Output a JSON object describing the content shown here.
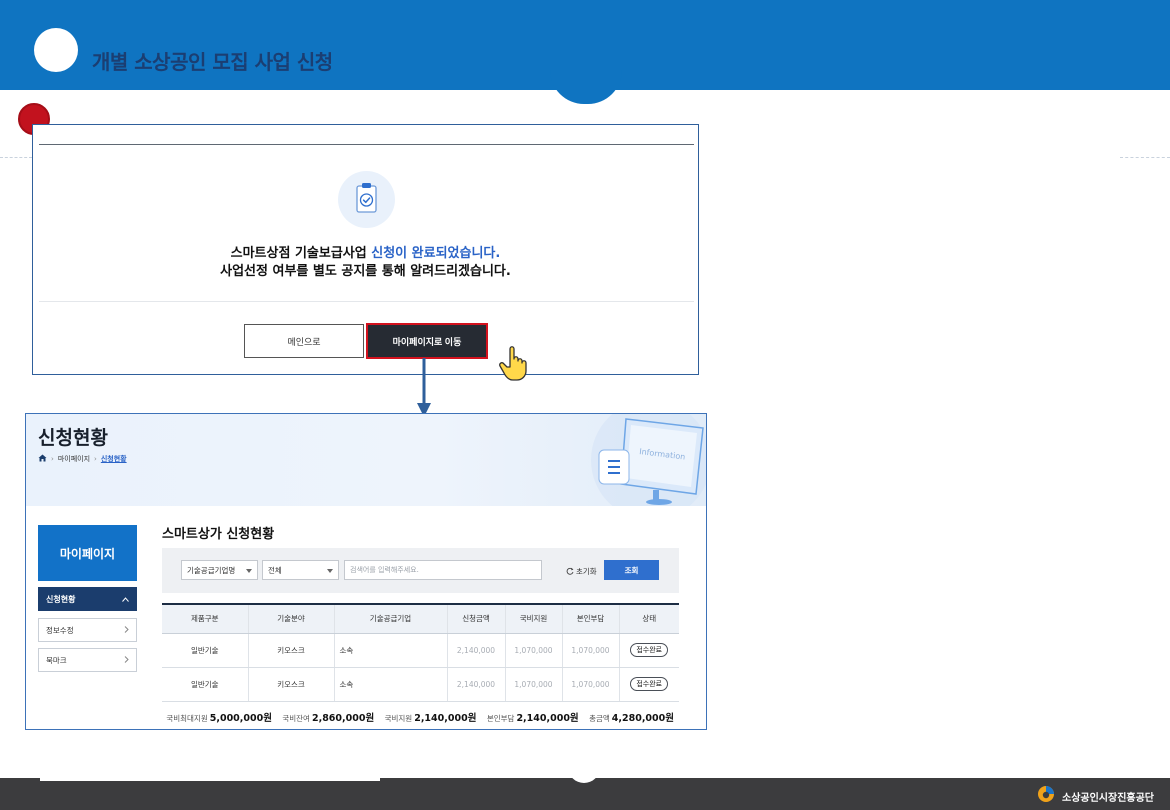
{
  "header": {
    "title": "개별 소상공인 모집 사업 신청"
  },
  "dialog": {
    "message_line1_prefix": "스마트상점 기술보급사업 ",
    "message_line1_highlight": "신청이 완료되었습니다.",
    "message_line2": "사업선정 여부를 별도 공지를 통해 알려드리겠습니다.",
    "main_button_label": "메인으로",
    "mypage_button_label": "마이페이지로 이동"
  },
  "status": {
    "title": "신청현황",
    "breadcrumb": [
      "마이페이지",
      "신청현황"
    ],
    "monitor_text": "Information",
    "sidebar": {
      "title": "마이페이지",
      "items": [
        {
          "label": "신청현황",
          "active": true
        },
        {
          "label": "정보수정",
          "active": false
        },
        {
          "label": "북마크",
          "active": false
        }
      ]
    },
    "section_title": "스마트상가 신청현황",
    "filters": {
      "select1": "기술공급기업명",
      "select2": "전체",
      "search_placeholder": "검색어를 입력해주세요.",
      "reset_label": "초기화",
      "search_button_label": "조회"
    },
    "table": {
      "headers": [
        "제품구분",
        "기술분야",
        "기술공급기업",
        "신청금액",
        "국비지원",
        "본인부담",
        "상태"
      ],
      "rows": [
        [
          "일반기술",
          "키오스크",
          "소속",
          "2,140,000",
          "1,070,000",
          "1,070,000",
          "접수완료"
        ],
        [
          "일반기술",
          "키오스크",
          "소속",
          "2,140,000",
          "1,070,000",
          "1,070,000",
          "접수완료"
        ]
      ]
    },
    "totals": [
      {
        "label": "국비최대지원",
        "value": "5,000,000원"
      },
      {
        "label": "국비잔여",
        "value": "2,860,000원"
      },
      {
        "label": "국비지원",
        "value": "2,140,000원"
      },
      {
        "label": "본인부담",
        "value": "2,140,000원"
      },
      {
        "label": "총금액",
        "value": "4,280,000원"
      }
    ]
  },
  "footer": {
    "org_name": "소상공인시장진흥공단"
  },
  "colors": {
    "brand_blue": "#0f74c1",
    "highlight_red": "#d3121e",
    "accent_blue": "#2a63c7"
  }
}
